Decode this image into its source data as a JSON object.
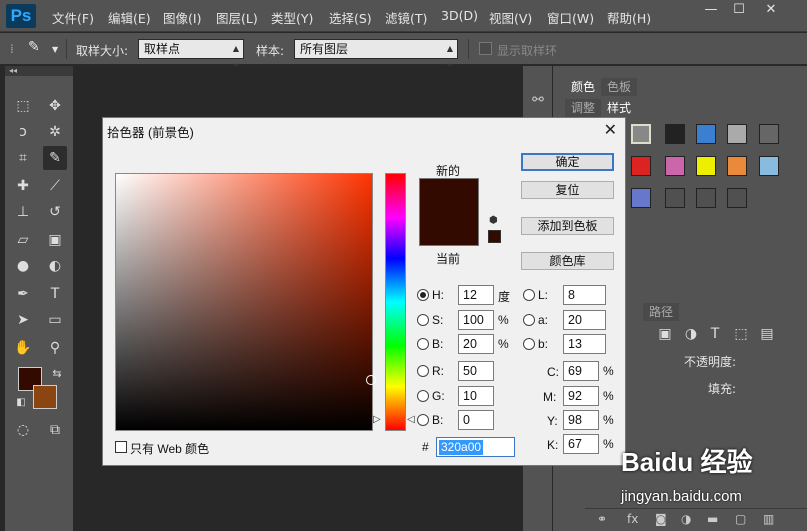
{
  "app": {
    "logo": "Ps"
  },
  "menu": [
    "文件(F)",
    "编辑(E)",
    "图像(I)",
    "图层(L)",
    "类型(Y)",
    "选择(S)",
    "滤镜(T)",
    "3D(D)",
    "视图(V)",
    "窗口(W)",
    "帮助(H)"
  ],
  "window_controls": {
    "minimize": "—",
    "maximize": "☐",
    "close": "✕"
  },
  "options": {
    "sample_size_label": "取样大小:",
    "sample_size_value": "取样点",
    "sample_label": "样本:",
    "sample_value": "所有图层",
    "show_ring_label": "显示取样环"
  },
  "toolbar": {
    "fg_color": "#320a00",
    "bg_color": "#8b4513"
  },
  "panels": {
    "tabs_top": [
      "颜色",
      "色板"
    ],
    "tabs_second": [
      "调整",
      "样式"
    ],
    "tabs_layers": [
      "路径"
    ],
    "opacity_label": "不透明度:",
    "fill_label": "填充:"
  },
  "dialog": {
    "title": "拾色器 (前景色)",
    "close": "✕",
    "new_label": "新的",
    "current_label": "当前",
    "ok": "确定",
    "reset": "复位",
    "add_swatch": "添加到色板",
    "color_libraries": "颜色库",
    "only_web": "只有 Web 颜色",
    "hsb": [
      {
        "label": "H:",
        "value": "12",
        "unit": "度"
      },
      {
        "label": "S:",
        "value": "100",
        "unit": "%"
      },
      {
        "label": "B:",
        "value": "20",
        "unit": "%"
      }
    ],
    "rgb": [
      {
        "label": "R:",
        "value": "50"
      },
      {
        "label": "G:",
        "value": "10"
      },
      {
        "label": "B:",
        "value": "0"
      }
    ],
    "lab": [
      {
        "label": "L:",
        "value": "8"
      },
      {
        "label": "a:",
        "value": "20"
      },
      {
        "label": "b:",
        "value": "13"
      }
    ],
    "cmyk": [
      {
        "label": "C:",
        "value": "69",
        "unit": "%"
      },
      {
        "label": "M:",
        "value": "92",
        "unit": "%"
      },
      {
        "label": "Y:",
        "value": "98",
        "unit": "%"
      },
      {
        "label": "K:",
        "value": "67",
        "unit": "%"
      }
    ],
    "hex_label": "#",
    "hex_value": "320a00"
  },
  "watermark": {
    "logo": "Baidu 经验",
    "url": "jingyan.baidu.com"
  }
}
